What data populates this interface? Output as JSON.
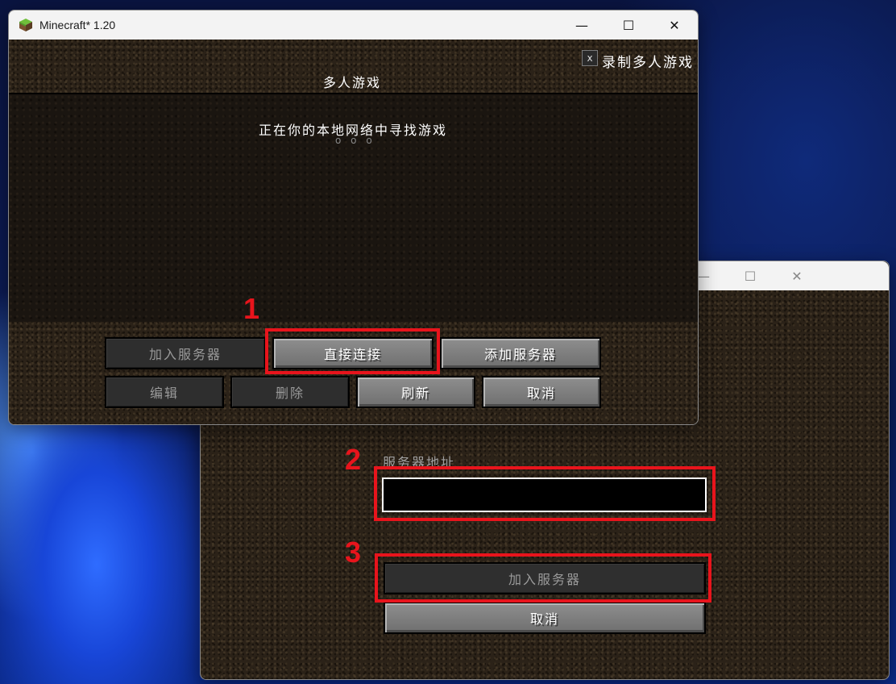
{
  "main_window": {
    "title": "Minecraft* 1.20",
    "controls": {
      "minimize": "—",
      "maximize": "☐",
      "close": "✕"
    },
    "record_checkbox": {
      "mark": "x",
      "label": "录制多人游戏"
    },
    "screen_title": "多人游戏",
    "lan_status": "正在你的本地网络中寻找游戏",
    "lan_dots": "o o o",
    "buttons": {
      "join_server": "加入服务器",
      "direct_connect": "直接连接",
      "add_server": "添加服务器",
      "edit": "编辑",
      "delete": "删除",
      "refresh": "刷新",
      "cancel": "取消"
    }
  },
  "direct_window": {
    "controls": {
      "minimize": "—",
      "maximize": "☐",
      "close": "✕"
    },
    "address_label": "服务器地址",
    "address_value": "",
    "join_button": "加入服务器",
    "cancel_button": "取消"
  },
  "annotations": {
    "step1": "1",
    "step2": "2",
    "step3": "3",
    "color": "#e8141c"
  }
}
